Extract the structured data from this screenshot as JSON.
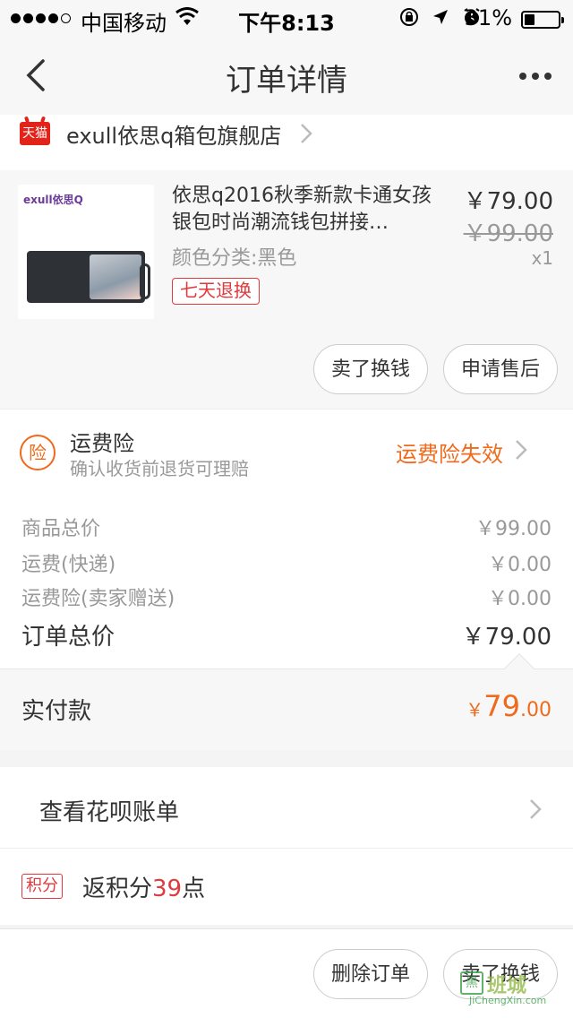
{
  "status_bar": {
    "carrier": "中国移动",
    "time": "下午8:13",
    "battery_pct": "31%",
    "battery_level": 0.31
  },
  "nav": {
    "title": "订单详情",
    "back_icon": "back-arrow-icon",
    "more_icon": "more-dots-icon"
  },
  "shop": {
    "badge": "天猫",
    "name": "exull依思q箱包旗舰店"
  },
  "product": {
    "image_brand": "exull依思Q",
    "title": "依思q2016秋季新款卡通女孩银包时尚潮流钱包拼接…",
    "variant": "颜色分类:黑色",
    "tag": "七天退换",
    "price": "￥79.00",
    "original_price": "￥99.00",
    "quantity": "x1",
    "buttons": {
      "sell": "卖了换钱",
      "after_sale": "申请售后"
    }
  },
  "insurance": {
    "icon_text": "险",
    "title": "运费险",
    "subtitle": "确认收货前退货可理赔",
    "status": "运费险失效"
  },
  "summary": {
    "rows": [
      {
        "label": "商品总价",
        "value": "￥99.00"
      },
      {
        "label": "运费(快递)",
        "value": "￥0.00"
      },
      {
        "label": "运费险(卖家赠送)",
        "value": "￥0.00"
      }
    ],
    "total_label": "订单总价",
    "total_value": "￥79.00"
  },
  "paid": {
    "label": "实付款",
    "symbol": "￥",
    "integer": "79",
    "decimal": ".00"
  },
  "huabei": {
    "label": "查看花呗账单"
  },
  "points": {
    "badge": "积分",
    "prefix": "返积分",
    "number": "39",
    "suffix": "点"
  },
  "footer": {
    "delete": "删除订单",
    "sell": "卖了换钱"
  },
  "watermark": {
    "mark": "黑",
    "name": "班城",
    "url": "JiChengXin.com"
  },
  "colors": {
    "accent_orange": "#f06a1b",
    "accent_red": "#e0393e",
    "tmall_red": "#e2231a"
  }
}
